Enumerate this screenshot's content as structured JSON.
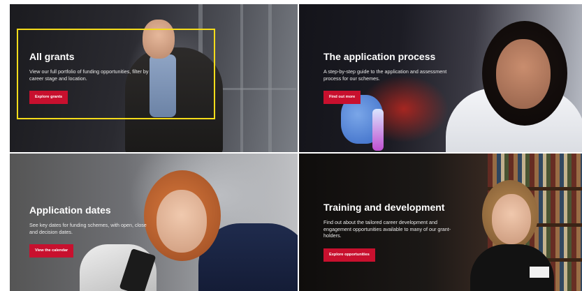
{
  "colors": {
    "accent": "#c8102e",
    "highlight": "#f5dc1a",
    "text": "#ffffff"
  },
  "tiles": [
    {
      "title": "All grants",
      "description": "View our full portfolio of funding opportunities, filter by career stage and location.",
      "cta": "Explore grants",
      "highlighted": true
    },
    {
      "title": "The application process",
      "description": "A step-by-step guide to the application and assessment process for our schemes.",
      "cta": "Find out more",
      "highlighted": false
    },
    {
      "title": "Application dates",
      "description": "See key dates for funding schemes, with open, close and decision dates.",
      "cta": "View the calendar",
      "highlighted": false
    },
    {
      "title": "Training and development",
      "description": "Find out about the tailored career development and engagement opportunities available to many of our grant-holders.",
      "cta": "Explore opportunities",
      "highlighted": false
    }
  ]
}
